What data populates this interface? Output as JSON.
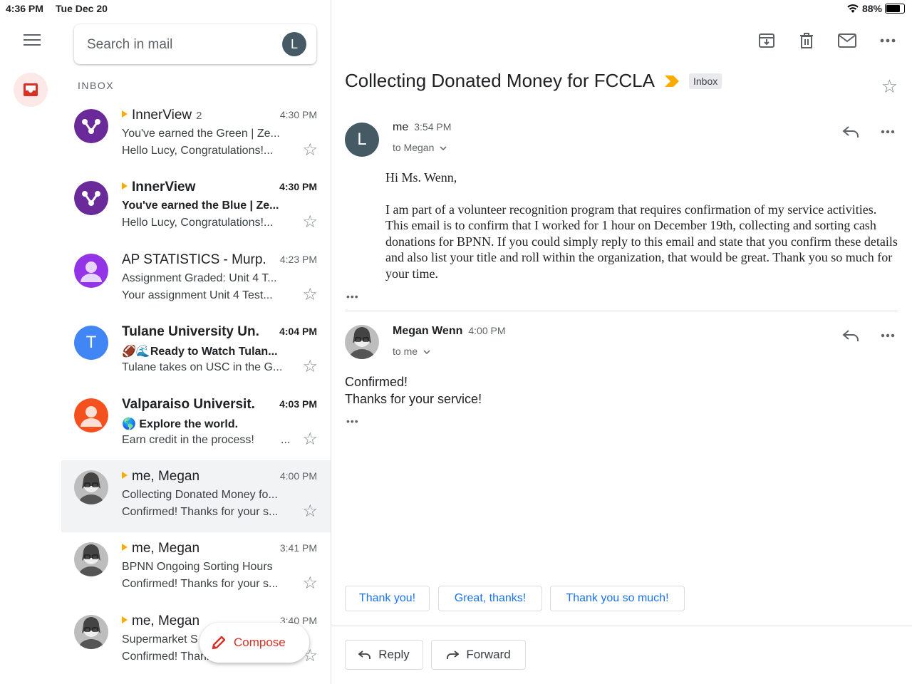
{
  "status_bar": {
    "time": "4:36 PM",
    "date": "Tue Dec 20",
    "battery": "88%",
    "battery_level": 0.88
  },
  "search": {
    "placeholder": "Search in mail",
    "account_initial": "L"
  },
  "inbox_label": "INBOX",
  "emails": [
    {
      "sender": "InnerView",
      "count": "2",
      "time": "4:30 PM",
      "subject": "You've earned the Green | Ze...",
      "snippet": "Hello Lucy, Congratulations!...",
      "important": true,
      "unread": false,
      "avatar": "innerview"
    },
    {
      "sender": "InnerView",
      "count": "",
      "time": "4:30 PM",
      "subject": "You've earned the Blue | Ze...",
      "snippet": "Hello Lucy, Congratulations!...",
      "important": true,
      "unread": true,
      "avatar": "innerview"
    },
    {
      "sender": "AP STATISTICS - Murp.",
      "count": "",
      "time": "4:23 PM",
      "subject": "Assignment Graded: Unit 4 T...",
      "snippet": "Your assignment Unit 4 Test...",
      "important": false,
      "unread": false,
      "avatar": "person-purple"
    },
    {
      "sender": "Tulane University Un.",
      "count": "",
      "time": "4:04 PM",
      "subject": "🏈🌊Ready to Watch Tulan...",
      "snippet": "Tulane takes on USC in the G...",
      "important": false,
      "unread": true,
      "avatar": "T"
    },
    {
      "sender": "Valparaiso Universit.",
      "count": "",
      "time": "4:03 PM",
      "subject": "🌎 Explore the world.",
      "snippet": "Earn credit in the process!",
      "snippet_trail": "...",
      "important": false,
      "unread": true,
      "avatar": "person-orange"
    },
    {
      "sender": "me, Megan",
      "count": "",
      "time": "4:00 PM",
      "subject": "Collecting Donated Money fo...",
      "snippet": "Confirmed! Thanks for your s...",
      "important": true,
      "unread": false,
      "avatar": "photo",
      "selected": true
    },
    {
      "sender": "me, Megan",
      "count": "",
      "time": "3:41 PM",
      "subject": "BPNN Ongoing Sorting Hours",
      "snippet": "Confirmed! Thanks for your s...",
      "important": true,
      "unread": false,
      "avatar": "photo"
    },
    {
      "sender": "me, Megan",
      "count": "",
      "time": "3:40 PM",
      "subject": "Supermarket S",
      "snippet": "Confirmed! Thanks for your s...",
      "important": true,
      "unread": false,
      "avatar": "photo"
    }
  ],
  "compose_label": "Compose",
  "thread": {
    "subject": "Collecting Donated Money for FCCLA",
    "label": "Inbox",
    "messages": [
      {
        "from": "me",
        "time": "3:54 PM",
        "to": "to Megan",
        "avatar_initial": "L",
        "greeting": "Hi Ms. Wenn,",
        "body": "I am part of a volunteer recognition program that requires confirmation of my service activities. This email is to confirm that I worked for 1 hour on December 19th, collecting and sorting cash donations for BPNN. If you could simply reply to this email and state that you confirm these details and also list your title and roll within the organization, that would be great. Thank you so much for your time."
      },
      {
        "from": "Megan Wenn",
        "time": "4:00 PM",
        "to": "to me",
        "line1": "Confirmed!",
        "line2": "Thanks for your service!"
      }
    ]
  },
  "smart_replies": [
    "Thank you!",
    "Great, thanks!",
    "Thank you so much!"
  ],
  "actions": {
    "reply": "Reply",
    "forward": "Forward"
  },
  "colors": {
    "accent_red": "#d93025",
    "link_blue": "#1a73e8",
    "important_yellow": "#f9ab00",
    "innerview_purple": "#6a2a9a"
  }
}
